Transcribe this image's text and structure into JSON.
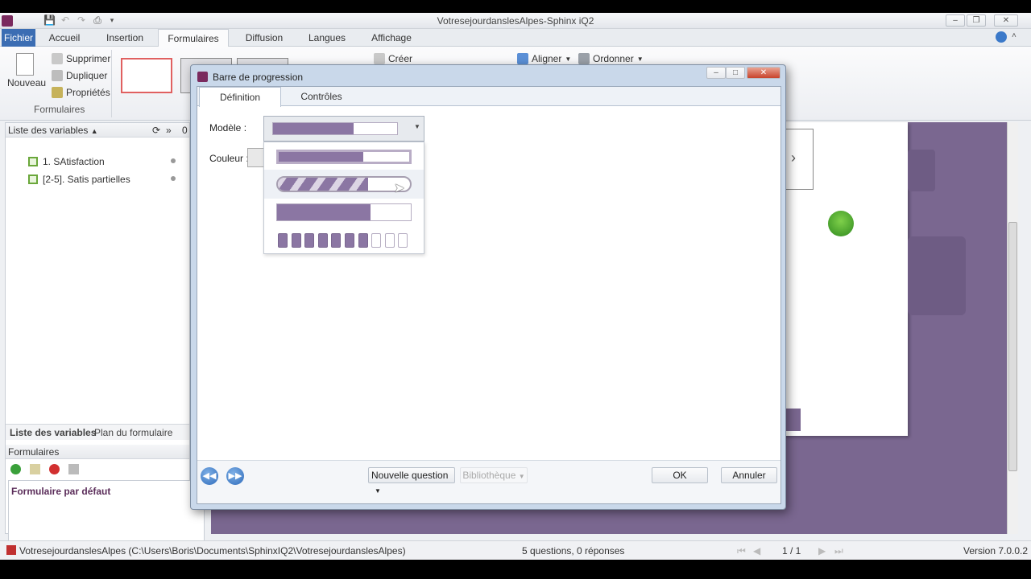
{
  "window": {
    "title": "VotresejourdanslesAlpes-Sphinx iQ2"
  },
  "ribbon_tabs": [
    "Fichier",
    "Accueil",
    "Insertion",
    "Formulaires",
    "Diffusion",
    "Langues",
    "Affichage"
  ],
  "ribbon": {
    "new_label": "Nouveau",
    "delete_label": "Supprimer",
    "duplicate_label": "Dupliquer",
    "properties_label": "Propriétés",
    "group_label": "Formulaires",
    "create_label": "Créer",
    "align_label": "Aligner",
    "order_label": "Ordonner"
  },
  "left_panel": {
    "header": "Liste des variables",
    "variables": [
      "1. SAtisfaction",
      "[2-5]. Satis partielles"
    ],
    "tab_variables": "Liste des variables",
    "tab_plan": "Plan du formulaire",
    "forms_header": "Formulaires",
    "forms": [
      "Formulaire par défaut"
    ],
    "pin": "0"
  },
  "dialog": {
    "title": "Barre de progression",
    "tabs": [
      "Définition",
      "Contrôles"
    ],
    "model_label": "Modèle :",
    "color_label": "Couleur :",
    "options": [
      {
        "style": "solid",
        "progress": 0.65
      },
      {
        "style": "striped",
        "progress": 0.68
      },
      {
        "style": "flat",
        "progress": 0.7
      },
      {
        "style": "segments",
        "progress": 0.7
      }
    ],
    "new_question_label": "Nouvelle question",
    "library_label": "Bibliothèque",
    "ok_label": "OK",
    "cancel_label": "Annuler"
  },
  "status": {
    "file_path": "VotresejourdanslesAlpes (C:\\Users\\Boris\\Documents\\SphinxIQ2\\VotresejourdanslesAlpes)",
    "summary": "5 questions, 0 réponses",
    "page": "1 / 1",
    "version": "Version 7.0.0.2"
  },
  "colors": {
    "accent": "#3b6db3",
    "bar_fill": "#8b76a3",
    "canvas": "#7a6790"
  }
}
